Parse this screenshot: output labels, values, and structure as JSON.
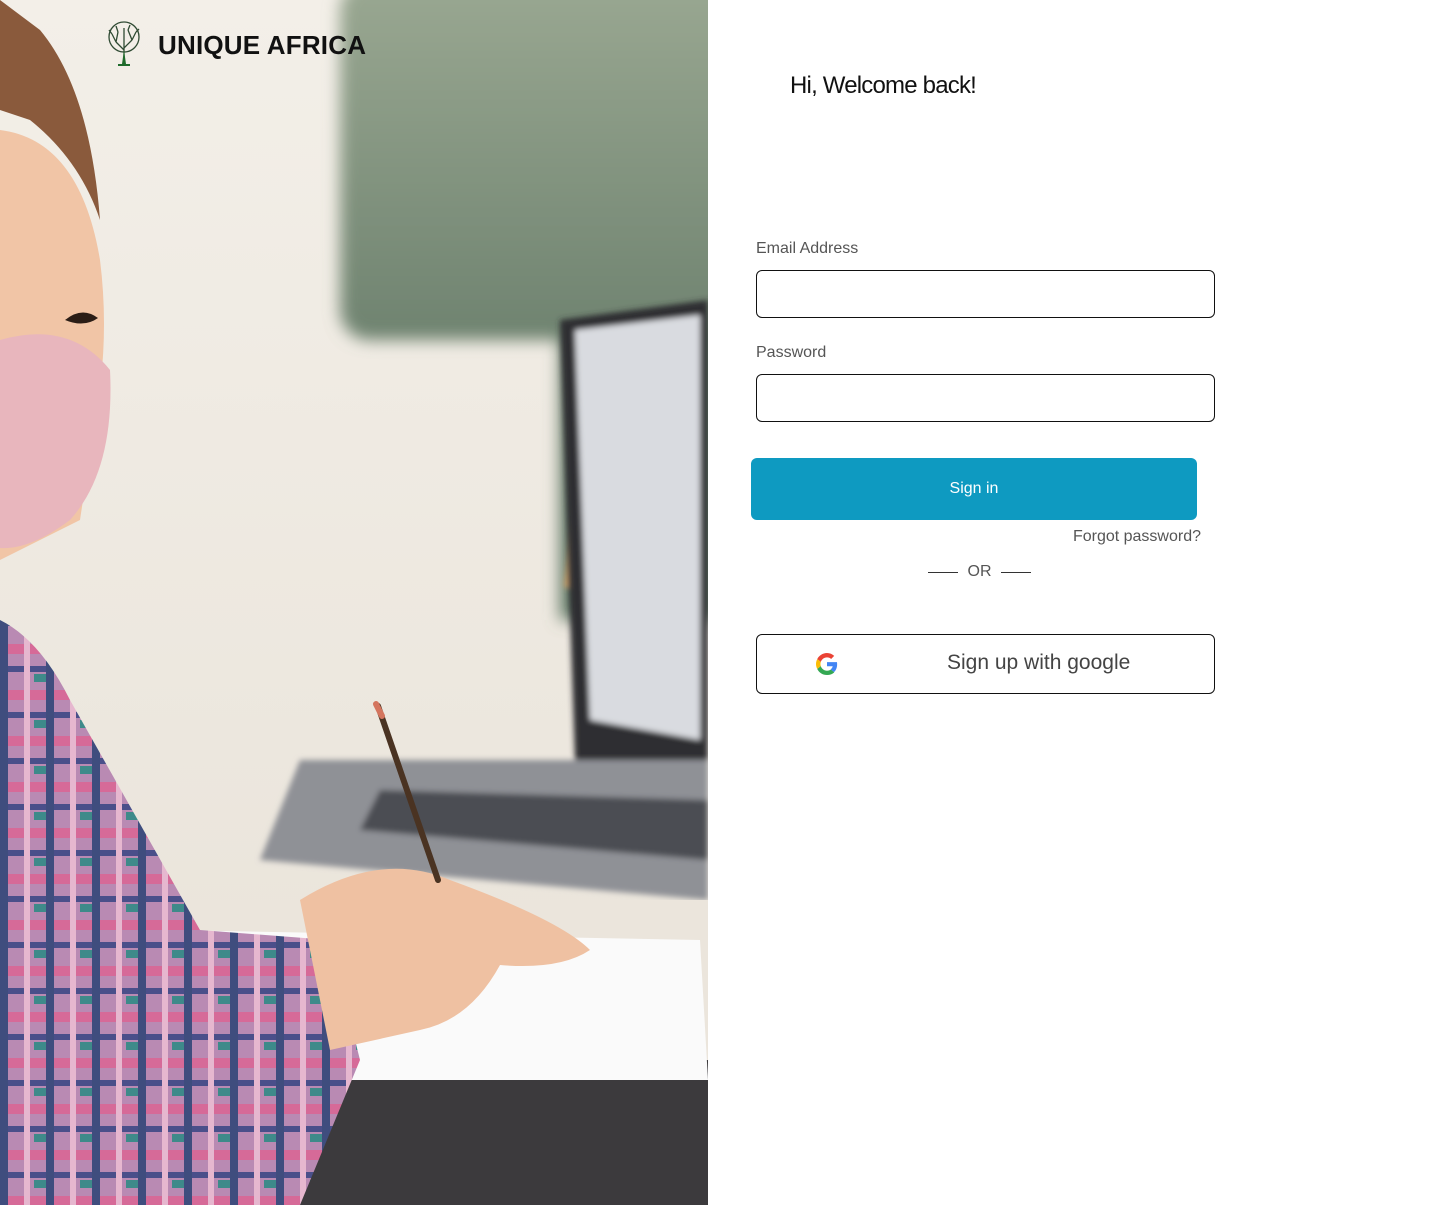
{
  "brand": {
    "name": "UNIQUE AFRICA",
    "logo_icon": "tree-icon"
  },
  "hero": {
    "image": "student-writing-photo"
  },
  "form": {
    "heading": "Hi, Welcome back!",
    "email": {
      "label": "Email Address",
      "value": "",
      "placeholder": ""
    },
    "password": {
      "label": "Password",
      "value": "",
      "placeholder": ""
    },
    "signin_label": "Sign in",
    "forgot_label": "Forgot password?",
    "divider_text": "OR",
    "google_label": "Sign up with google",
    "google_icon": "google-icon"
  },
  "colors": {
    "primary": "#0e9ac1",
    "text_dark": "#111111",
    "text_muted": "#555555",
    "border": "#111111"
  }
}
